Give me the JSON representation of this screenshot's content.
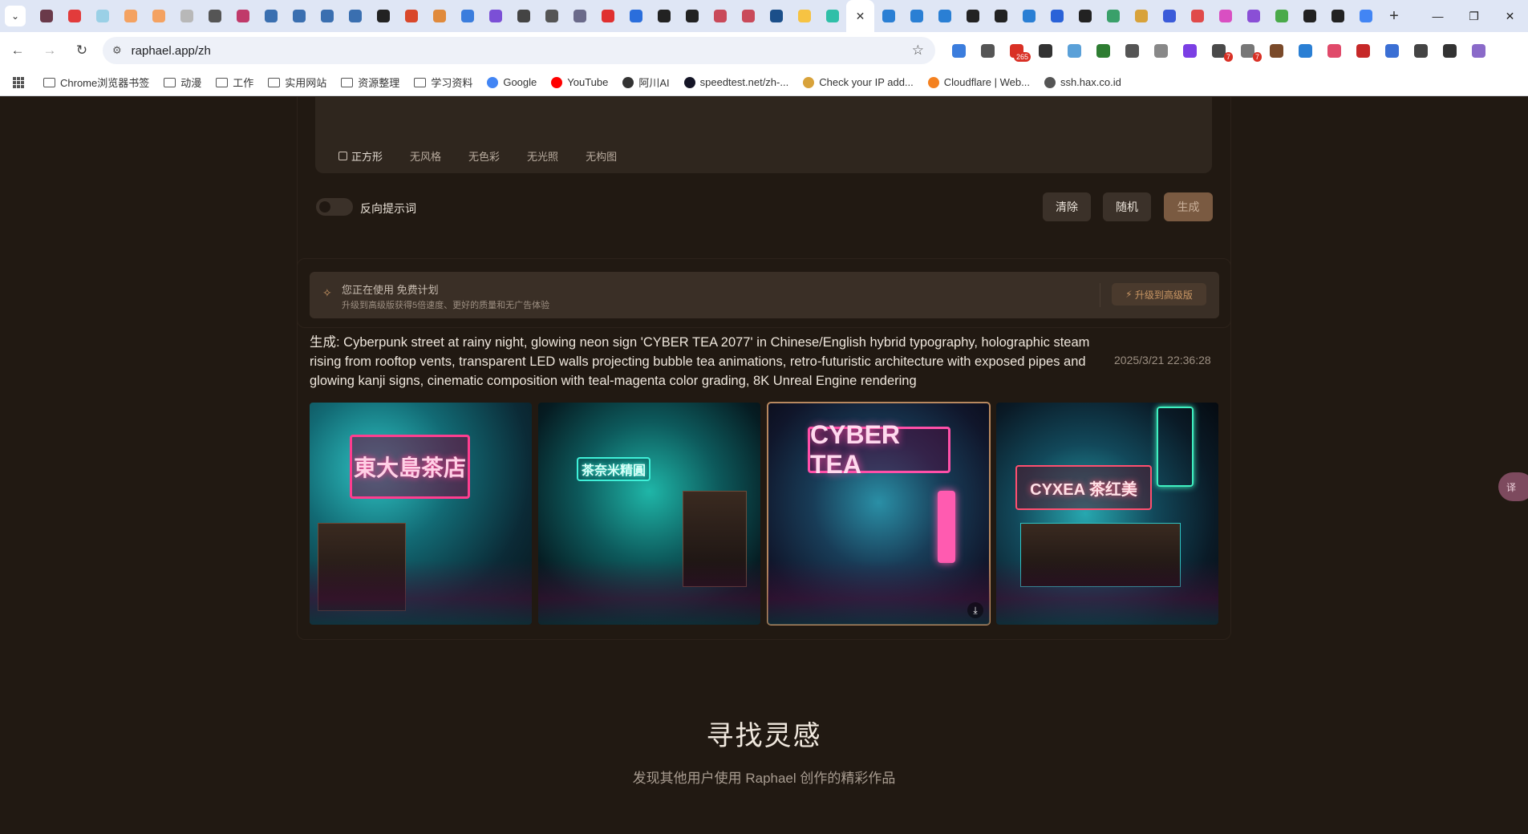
{
  "browser": {
    "url": "raphael.app/zh",
    "tab_colors": [
      "#6a3a4a",
      "#e23b3b",
      "#9ad0e6",
      "#f4a261",
      "#f4a261",
      "#b8b8b8",
      "#555555",
      "#c03a6a",
      "#3a6fb0",
      "#3a6fb0",
      "#3a6fb0",
      "#3a6fb0",
      "#222222",
      "#d9482b",
      "#e08a3c",
      "#3b7ddd",
      "#7b4fd6",
      "#444444",
      "#555555",
      "#6a6a8a",
      "#e03030",
      "#2a6edc",
      "#222222",
      "#222222",
      "#c94a5a",
      "#c94a5a",
      "#1b4f8a",
      "#f6c343",
      "#2fbfa8",
      "#ffffff",
      "#2a7fd4",
      "#2a7fd4",
      "#2a7fd4",
      "#222222",
      "#222222",
      "#2a7fd4",
      "#2a62d8",
      "#222222",
      "#3aa06a",
      "#d8a23a",
      "#3b5bd9",
      "#e04a4a",
      "#d94fc2",
      "#8a4fd6",
      "#4aaa4a",
      "#222222",
      "#222222",
      "#4285f4"
    ],
    "active_tab_index": 29,
    "extension_icon_colors": [
      "#3b7ddd",
      "#555555",
      "#d93025",
      "#333333",
      "#5aa0d8",
      "#2e7d32",
      "#555555",
      "#888888",
      "#7b3fe4",
      "#4a4a4a",
      "#777777",
      "#7a4a2a",
      "#2a7fd4",
      "#e04a6a",
      "#c62828",
      "#3b6fd4",
      "#444444",
      "#333333",
      "#8a6ac9"
    ],
    "extension_badges": [
      "265",
      "7",
      "7"
    ],
    "bookmarks": [
      {
        "label": "Chrome浏览器书签",
        "icon": "folder-icon"
      },
      {
        "label": "动漫",
        "icon": "folder-icon"
      },
      {
        "label": "工作",
        "icon": "folder-icon"
      },
      {
        "label": "实用网站",
        "icon": "folder-icon"
      },
      {
        "label": "资源整理",
        "icon": "folder-icon"
      },
      {
        "label": "学习资料",
        "icon": "folder-icon"
      },
      {
        "label": "Google",
        "icon": "google-icon"
      },
      {
        "label": "YouTube",
        "icon": "youtube-icon"
      },
      {
        "label": "阿川AI",
        "icon": "openai-icon"
      },
      {
        "label": "speedtest.net/zh-...",
        "icon": "speedtest-icon"
      },
      {
        "label": "Check your IP add...",
        "icon": "ip-check-icon"
      },
      {
        "label": "Cloudflare | Web...",
        "icon": "cloudflare-icon"
      },
      {
        "label": "ssh.hax.co.id",
        "icon": "image-icon"
      }
    ]
  },
  "editor": {
    "style_chips": [
      "正方形",
      "无风格",
      "无色彩",
      "无光照",
      "无构图"
    ],
    "negative_prompt_label": "反向提示词",
    "clear_label": "清除",
    "random_label": "随机",
    "generate_label": "生成"
  },
  "plan": {
    "line1": "您正在使用 免费计划",
    "line2": "升级到高级版获得5倍速度、更好的质量和无广告体验",
    "upgrade_label": "升级到高级版"
  },
  "generation": {
    "prompt_text": "生成: Cyberpunk street at rainy night, glowing neon sign 'CYBER TEA 2077' in Chinese/English hybrid typography, holographic steam rising from rooftop vents, transparent LED walls projecting bubble tea animations, retro-futuristic architecture with exposed pipes and glowing kanji signs, cinematic composition with teal-magenta color grading, 8K Unreal Engine rendering",
    "timestamp": "2025/3/21 22:36:28",
    "images": [
      {
        "sign": "東大島茶店",
        "sign_color": "#ff3d8f"
      },
      {
        "sign": "茶奈米精圓",
        "sign_color": "#3ff0d8"
      },
      {
        "sign": "CYBER TEA",
        "sign_color": "#ff4fa8"
      },
      {
        "sign": "CYXEA 茶红美",
        "sign_color": "#ff4f6f"
      }
    ]
  },
  "inspiration": {
    "title": "寻找灵感",
    "subtitle": "发现其他用户使用 Raphael 创作的精彩作品"
  },
  "side_widget_label": "译"
}
